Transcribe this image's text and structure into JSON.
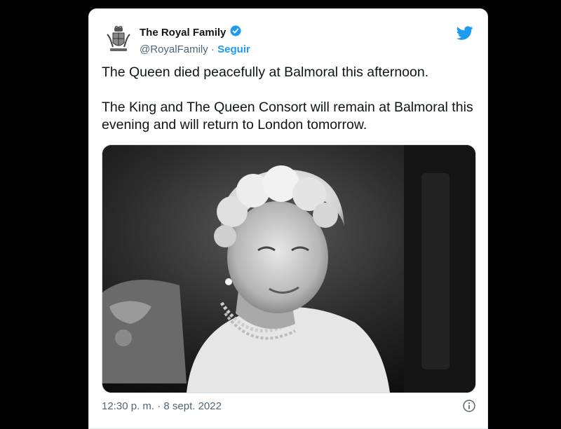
{
  "tweet": {
    "display_name": "The Royal Family",
    "handle": "@RoyalFamily",
    "separator": " · ",
    "follow_label": "Seguir",
    "paragraphs": [
      "The Queen died peacefully at Balmoral this afternoon.",
      "The King and The Queen Consort will remain at Balmoral this evening and will return to London tomorrow."
    ],
    "timestamp": "12:30 p. m. · 8 sept. 2022",
    "icons": {
      "avatar": "royal-coat-of-arms-icon",
      "verified": "verified-badge-icon",
      "brand": "twitter-bird-icon",
      "info": "info-icon"
    },
    "media": {
      "description_kind": "black-and-white-portrait-photo"
    }
  },
  "colors": {
    "accent": "#1d9bf0",
    "text": "#0f1419",
    "muted": "#536471",
    "border": "#cfd9de",
    "backdrop": "#000000"
  }
}
